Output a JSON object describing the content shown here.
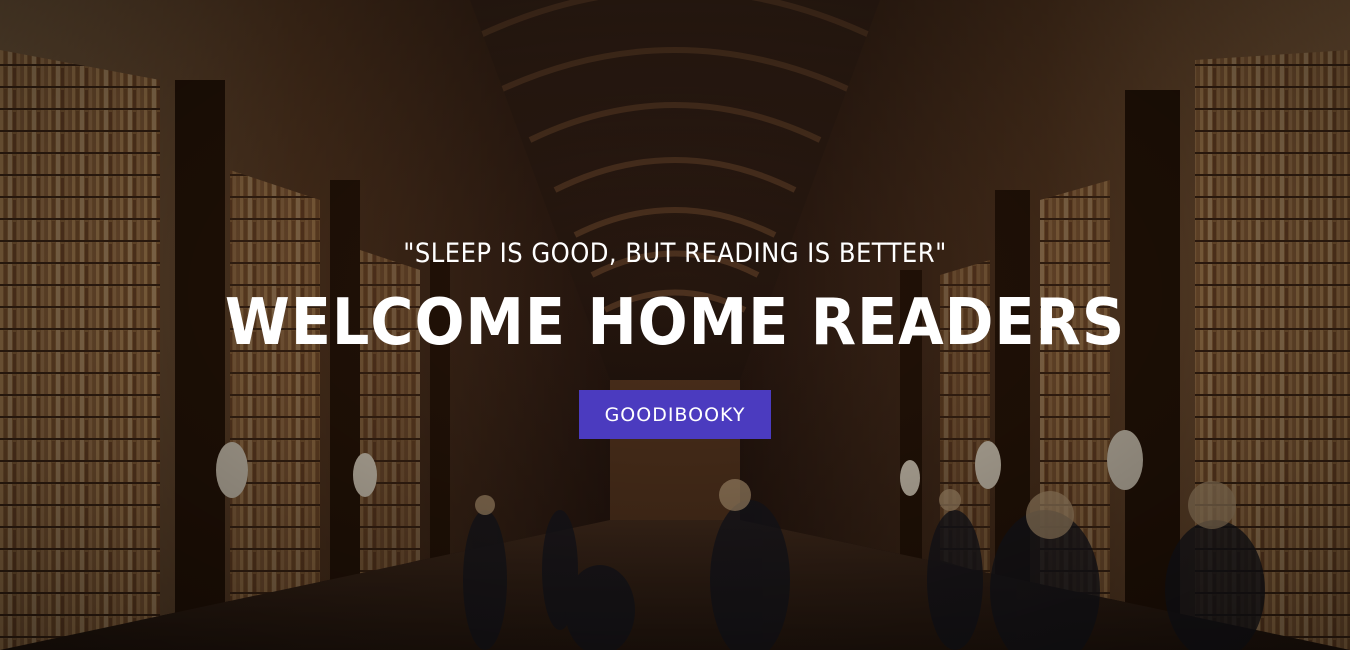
{
  "hero": {
    "tagline": "\"SLEEP IS GOOD, BUT READING IS BETTER\"",
    "headline": "WELCOME HOME READERS",
    "cta_label": "GOODIBOOKY"
  },
  "colors": {
    "cta_background": "#4b3bbf",
    "text": "#ffffff"
  }
}
